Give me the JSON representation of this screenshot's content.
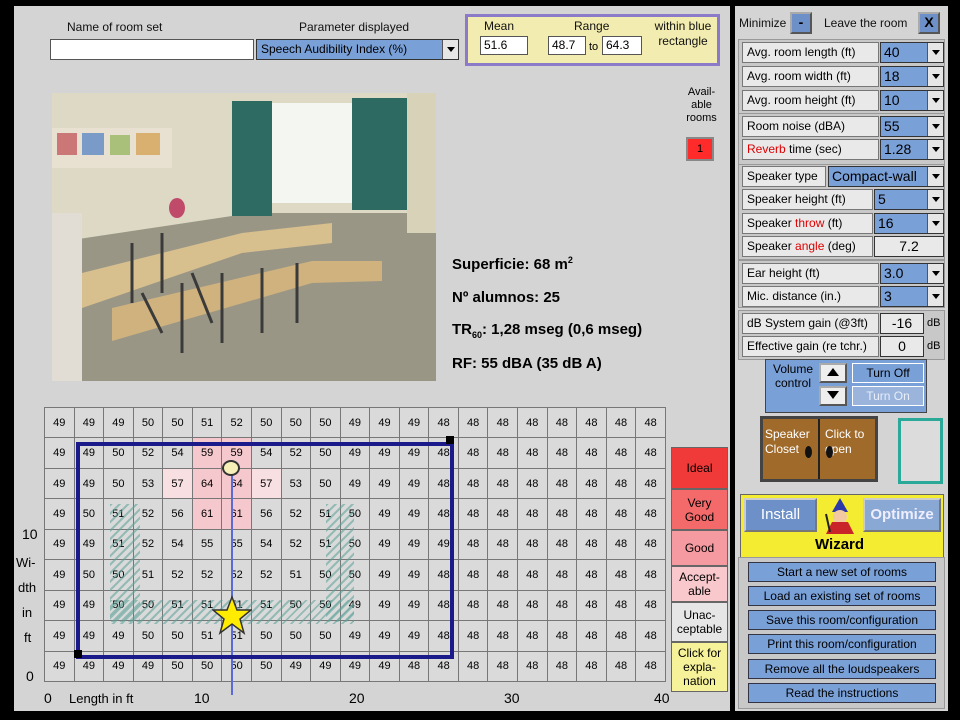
{
  "room_set": {
    "label": "Name of room set",
    "value": ""
  },
  "parameter": {
    "label": "Parameter displayed",
    "value": "Speech Audibility Index (%)"
  },
  "stats": {
    "mean_label": "Mean",
    "range_label": "Range",
    "within_label": "within blue rectangle",
    "mean": "51.6",
    "range_min": "48.7",
    "to": "to",
    "range_max": "64.3"
  },
  "available_rooms": {
    "label": "Avail-able rooms",
    "value": "1"
  },
  "room_info": {
    "superficie": "Superficie: 68 m",
    "superficie_sup": "2",
    "alumnos": "Nº alumnos: 25",
    "tr_prefix": "TR",
    "tr_sub": "60",
    "tr_suffix": ": 1,28 mseg (0,6 mseg)",
    "rf": "RF: 55 dBA (35 dB A)"
  },
  "grid": {
    "rows": [
      [
        49,
        49,
        49,
        50,
        50,
        51,
        52,
        50,
        50,
        50,
        49,
        49,
        49,
        48,
        48,
        48,
        48,
        48,
        48,
        48,
        48
      ],
      [
        49,
        49,
        50,
        52,
        54,
        59,
        59,
        54,
        52,
        50,
        49,
        49,
        49,
        48,
        48,
        48,
        48,
        48,
        48,
        48,
        48
      ],
      [
        49,
        49,
        50,
        53,
        57,
        64,
        64,
        57,
        53,
        50,
        49,
        49,
        49,
        48,
        48,
        48,
        48,
        48,
        48,
        48,
        48
      ],
      [
        49,
        50,
        51,
        52,
        56,
        61,
        61,
        56,
        52,
        51,
        50,
        49,
        49,
        48,
        48,
        48,
        48,
        48,
        48,
        48,
        48
      ],
      [
        49,
        49,
        51,
        52,
        54,
        55,
        55,
        54,
        52,
        51,
        50,
        49,
        49,
        49,
        48,
        48,
        48,
        48,
        48,
        48,
        48
      ],
      [
        49,
        50,
        50,
        51,
        52,
        52,
        52,
        52,
        51,
        50,
        50,
        49,
        49,
        48,
        48,
        48,
        48,
        48,
        48,
        48,
        48
      ],
      [
        49,
        49,
        50,
        50,
        51,
        51,
        51,
        51,
        50,
        50,
        49,
        49,
        49,
        48,
        48,
        48,
        48,
        48,
        48,
        48,
        48
      ],
      [
        49,
        49,
        49,
        50,
        50,
        51,
        51,
        50,
        50,
        50,
        49,
        49,
        49,
        48,
        48,
        48,
        48,
        48,
        48,
        48,
        48
      ],
      [
        49,
        49,
        49,
        49,
        50,
        50,
        50,
        50,
        49,
        49,
        49,
        49,
        48,
        48,
        48,
        48,
        48,
        48,
        48,
        48,
        48
      ]
    ],
    "x_ticks": [
      "0",
      "10",
      "20",
      "30",
      "40"
    ],
    "x_label": "Length in ft",
    "y_ticks": [
      "10",
      "0"
    ],
    "y_label_1": "Wi-",
    "y_label_2": "dth",
    "y_label_3": "in",
    "y_label_4": "ft"
  },
  "legend": {
    "ideal": "Ideal",
    "very_good": "Very Good",
    "good": "Good",
    "acceptable": "Accept-able",
    "unacceptable": "Unac-ceptable",
    "explanation": "Click for expla-nation"
  },
  "side": {
    "minimize": "Minimize",
    "minimize_btn": "-",
    "leave": "Leave the room",
    "leave_btn": "X",
    "room_length_label": "Avg. room length (ft)",
    "room_length": "40",
    "room_width_label": "Avg. room width (ft)",
    "room_width": "18",
    "room_height_label": "Avg. room height (ft)",
    "room_height": "10",
    "room_noise_label": "Room noise (dBA)",
    "room_noise": "55",
    "reverb_a": "Reverb",
    "reverb_b": " time (sec)",
    "reverb": "1.28",
    "speaker_type_label": "Speaker type",
    "speaker_type": "Compact-wall",
    "speaker_height_label": "Speaker height (ft)",
    "speaker_height": "5",
    "speaker_throw_a": "Speaker ",
    "speaker_throw_b": "throw",
    "speaker_throw_c": " (ft)",
    "speaker_throw": "16",
    "speaker_angle_a": "Speaker ",
    "speaker_angle_b": "angle",
    "speaker_angle_c": " (deg)",
    "speaker_angle": "7.2",
    "ear_height_label": "Ear height (ft)",
    "ear_height": "3.0",
    "mic_label": "Mic. distance (in.)",
    "mic": "3",
    "sys_gain_label": "dB System gain (@3ft)",
    "sys_gain": "-16",
    "eff_gain_label": "Effective gain (re tchr.)",
    "eff_gain": "0",
    "db": "dB",
    "volume_label": "Volume control",
    "turn_off": "Turn Off",
    "turn_on": "Turn On",
    "closet": "Speaker Closet",
    "click_open": "Click to open",
    "install": "Install",
    "optimize": "Optimize",
    "wizard": "Wizard",
    "actions": [
      "Start a new set of rooms",
      "Load an existing  set of rooms",
      "Save this room/configuration",
      "Print this room/configuration",
      "Remove all the loudspeakers",
      "Read the instructions"
    ]
  }
}
